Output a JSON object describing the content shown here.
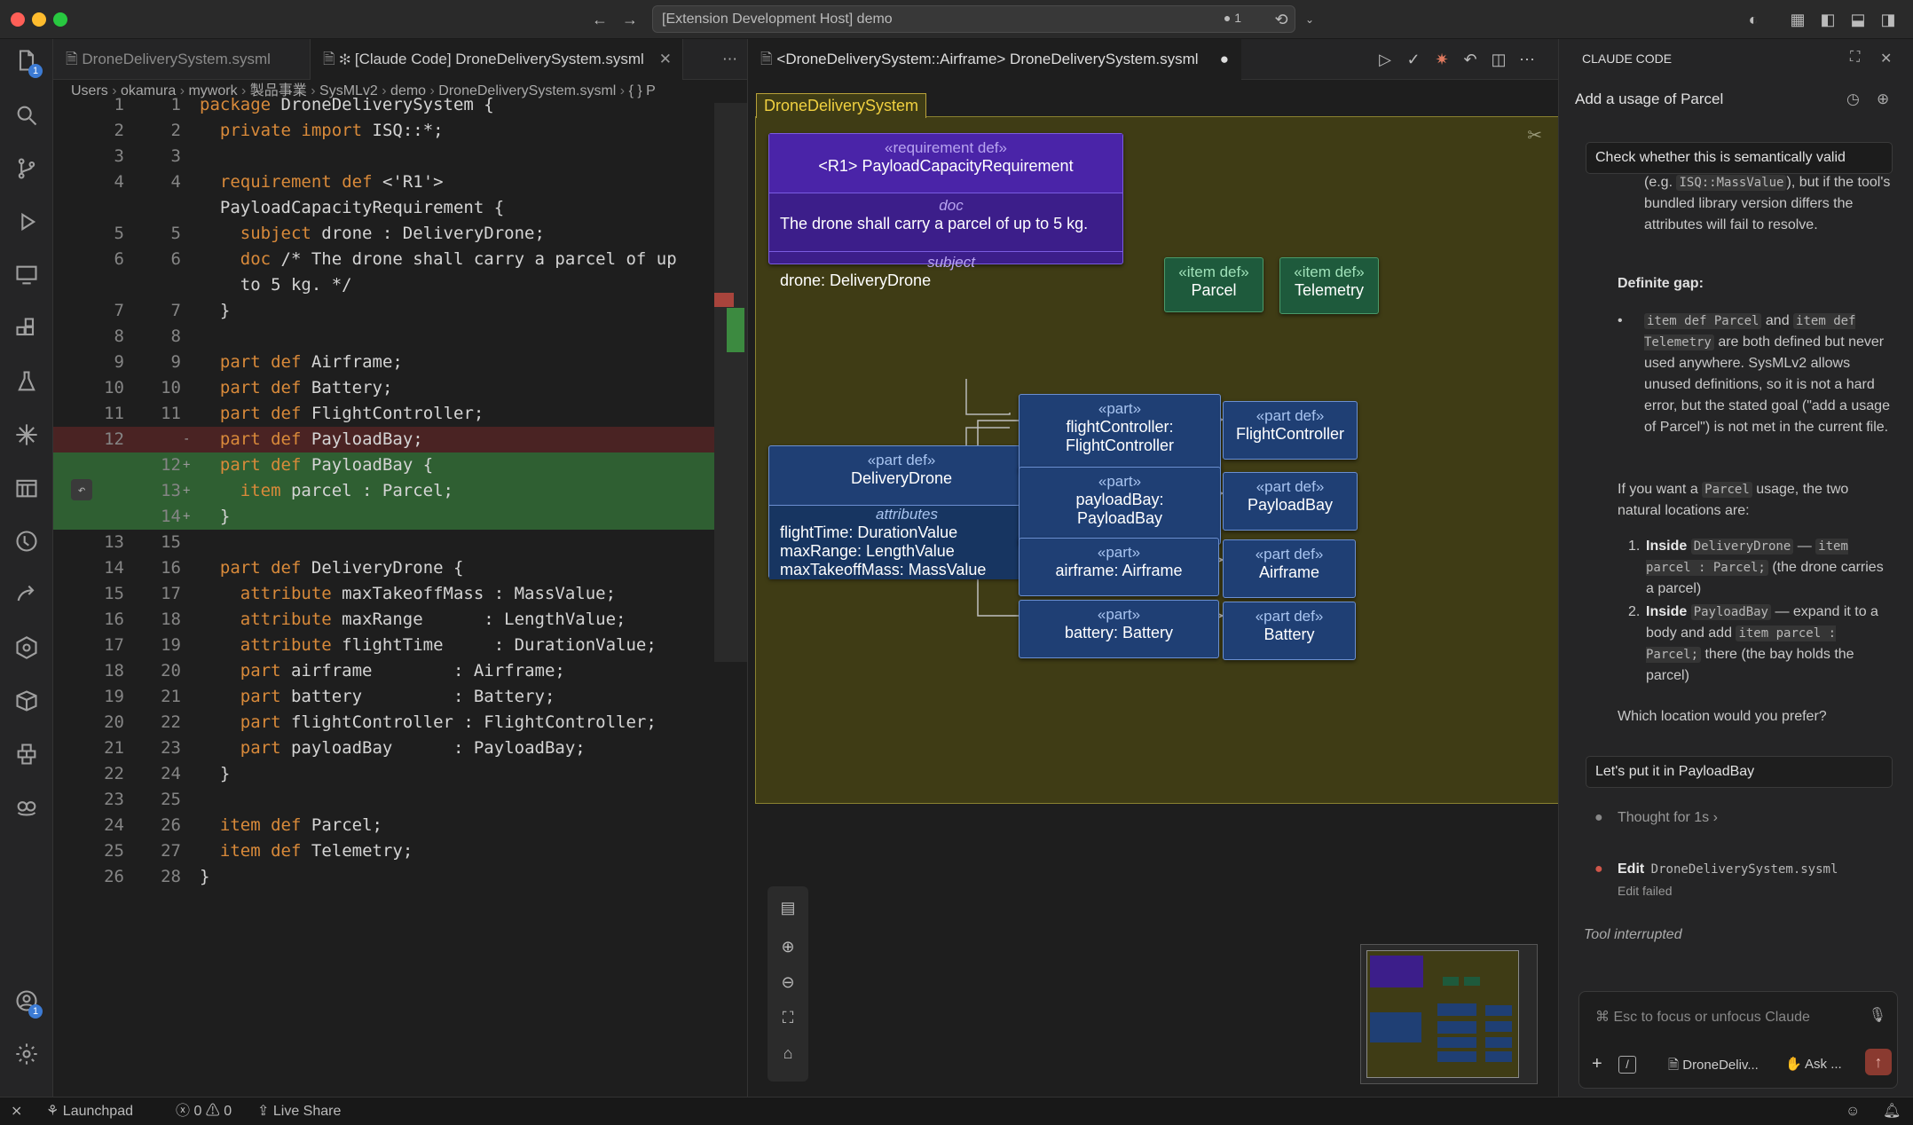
{
  "window": {
    "title": "[Extension Development Host] demo",
    "notif_count": "1"
  },
  "activity": {
    "explorer_badge": "1",
    "account_badge": "1"
  },
  "editor_tabs": [
    {
      "label": "DroneDeliverySystem.sysml"
    },
    {
      "label": "✻ [Claude Code] DroneDeliverySystem.sysml"
    }
  ],
  "breadcrumb": [
    "Users",
    "okamura",
    "mywork",
    "製品事業",
    "SysMLv2",
    "demo",
    "DroneDeliverySystem.sysml",
    "{ } P"
  ],
  "code_lines": [
    {
      "ln1": "1",
      "ln2": "1",
      "mark": "",
      "text": "package DroneDeliverySystem {",
      "kind": "normal"
    },
    {
      "ln1": "2",
      "ln2": "2",
      "mark": "",
      "text": "  private import ISQ::*;",
      "kind": "normal"
    },
    {
      "ln1": "3",
      "ln2": "3",
      "mark": "",
      "text": "",
      "kind": "normal"
    },
    {
      "ln1": "4",
      "ln2": "4",
      "mark": "",
      "text": "  requirement def <'R1'>",
      "kind": "normal"
    },
    {
      "ln1": "",
      "ln2": "",
      "mark": "",
      "text": "  PayloadCapacityRequirement {",
      "kind": "normal"
    },
    {
      "ln1": "5",
      "ln2": "5",
      "mark": "",
      "text": "    subject drone : DeliveryDrone;",
      "kind": "normal"
    },
    {
      "ln1": "6",
      "ln2": "6",
      "mark": "",
      "text": "    doc /* The drone shall carry a parcel of up",
      "kind": "normal"
    },
    {
      "ln1": "",
      "ln2": "",
      "mark": "",
      "text": "    to 5 kg. */",
      "kind": "normal"
    },
    {
      "ln1": "7",
      "ln2": "7",
      "mark": "",
      "text": "  }",
      "kind": "normal"
    },
    {
      "ln1": "8",
      "ln2": "8",
      "mark": "",
      "text": "",
      "kind": "normal"
    },
    {
      "ln1": "9",
      "ln2": "9",
      "mark": "",
      "text": "  part def Airframe;",
      "kind": "normal"
    },
    {
      "ln1": "10",
      "ln2": "10",
      "mark": "",
      "text": "  part def Battery;",
      "kind": "normal"
    },
    {
      "ln1": "11",
      "ln2": "11",
      "mark": "",
      "text": "  part def FlightController;",
      "kind": "normal"
    },
    {
      "ln1": "12",
      "ln2": "",
      "mark": "-",
      "text": "  part def PayloadBay;",
      "kind": "del"
    },
    {
      "ln1": "",
      "ln2": "12",
      "mark": "+",
      "text": "  part def PayloadBay {",
      "kind": "add"
    },
    {
      "ln1": "",
      "ln2": "13",
      "mark": "+",
      "text": "    item parcel : Parcel;",
      "kind": "add"
    },
    {
      "ln1": "",
      "ln2": "14",
      "mark": "+",
      "text": "  }",
      "kind": "add"
    },
    {
      "ln1": "13",
      "ln2": "15",
      "mark": "",
      "text": "",
      "kind": "normal"
    },
    {
      "ln1": "14",
      "ln2": "16",
      "mark": "",
      "text": "  part def DeliveryDrone {",
      "kind": "normal"
    },
    {
      "ln1": "15",
      "ln2": "17",
      "mark": "",
      "text": "    attribute maxTakeoffMass : MassValue;",
      "kind": "normal"
    },
    {
      "ln1": "16",
      "ln2": "18",
      "mark": "",
      "text": "    attribute maxRange      : LengthValue;",
      "kind": "normal"
    },
    {
      "ln1": "17",
      "ln2": "19",
      "mark": "",
      "text": "    attribute flightTime     : DurationValue;",
      "kind": "normal"
    },
    {
      "ln1": "18",
      "ln2": "20",
      "mark": "",
      "text": "    part airframe        : Airframe;",
      "kind": "normal"
    },
    {
      "ln1": "19",
      "ln2": "21",
      "mark": "",
      "text": "    part battery         : Battery;",
      "kind": "normal"
    },
    {
      "ln1": "20",
      "ln2": "22",
      "mark": "",
      "text": "    part flightController : FlightController;",
      "kind": "normal"
    },
    {
      "ln1": "21",
      "ln2": "23",
      "mark": "",
      "text": "    part payloadBay      : PayloadBay;",
      "kind": "normal"
    },
    {
      "ln1": "22",
      "ln2": "24",
      "mark": "",
      "text": "  }",
      "kind": "normal"
    },
    {
      "ln1": "23",
      "ln2": "25",
      "mark": "",
      "text": "",
      "kind": "normal"
    },
    {
      "ln1": "24",
      "ln2": "26",
      "mark": "",
      "text": "  item def Parcel;",
      "kind": "normal"
    },
    {
      "ln1": "25",
      "ln2": "27",
      "mark": "",
      "text": "  item def Telemetry;",
      "kind": "normal"
    },
    {
      "ln1": "26",
      "ln2": "28",
      "mark": "",
      "text": "}",
      "kind": "normal"
    }
  ],
  "diagram": {
    "tab_label": "<DroneDeliverySystem::Airframe> DroneDeliverySystem.sysml",
    "package_name": "DroneDeliverySystem",
    "requirement": {
      "stereotype": "«requirement def»",
      "name": "<R1> PayloadCapacityRequirement",
      "doc_label": "doc",
      "doc": "The drone shall carry a parcel of up to 5 kg.",
      "subject_label": "subject",
      "subject": "drone: DeliveryDrone"
    },
    "parcel": {
      "stereotype": "«item def»",
      "name": "Parcel"
    },
    "telemetry": {
      "stereotype": "«item def»",
      "name": "Telemetry"
    },
    "drone": {
      "stereotype": "«part def»",
      "name": "DeliveryDrone",
      "attr_label": "attributes",
      "attrs": [
        "flightTime: DurationValue",
        "maxRange: LengthValue",
        "maxTakeoffMass: MassValue"
      ]
    },
    "parts": [
      {
        "stereotype": "«part»",
        "name": "flightController: FlightController",
        "def_stereotype": "«part def»",
        "def_name": "FlightController"
      },
      {
        "stereotype": "«part»",
        "name": "payloadBay: PayloadBay",
        "def_stereotype": "«part def»",
        "def_name": "PayloadBay"
      },
      {
        "stereotype": "«part»",
        "name": "airframe: Airframe",
        "def_stereotype": "«part def»",
        "def_name": "Airframe"
      },
      {
        "stereotype": "«part»",
        "name": "battery: Battery",
        "def_stereotype": "«part def»",
        "def_name": "Battery"
      }
    ]
  },
  "claude": {
    "header": "CLAUDE CODE",
    "subtitle": "Add a usage of Parcel",
    "user_msg1": "Check whether this is semantically valid",
    "p1_a": "(e.g.",
    "p1_code": "ISQ::MassValue",
    "p1_b": "), but if the tool's bundled library version differs the attributes will fail to resolve.",
    "gap_title": "Definite gap:",
    "gap_code1": "item def Parcel",
    "gap_and": "and",
    "gap_code2": "item def Telemetry",
    "gap_text": "are both defined but never used anywhere. SysMLv2 allows unused definitions, so it is not a hard error, but the stated goal (\"add a usage of Parcel\") is not met in the current file.",
    "want_a": "If you want a",
    "want_code": "Parcel",
    "want_b": "usage, the two natural locations are:",
    "opt1_title": "Inside",
    "opt1_code": "DeliveryDrone",
    "opt1_dash": "—",
    "opt1_code2": "item parcel : Parcel;",
    "opt1_text": "(the drone carries a parcel)",
    "opt2_title": "Inside",
    "opt2_code": "PayloadBay",
    "opt2_text": "— expand it to a body and add",
    "opt2_code2": "item parcel : Parcel;",
    "opt2_text2": "there (the bay holds the parcel)",
    "question": "Which location would you prefer?",
    "user_msg2": "Let's put it in PayloadBay",
    "thought": "Thought for 1s",
    "edit_label": "Edit",
    "edit_file": "DroneDeliverySystem.sysml",
    "edit_status": "Edit failed",
    "interrupted": "Tool interrupted",
    "input_placeholder": "⌘ Esc to focus or unfocus Claude",
    "file_chip": "DroneDeliv...",
    "mode_chip": "Ask ..."
  },
  "status": {
    "launchpad": "Launchpad",
    "errors": "0",
    "warnings": "0",
    "live_share": "Live Share"
  },
  "colors": {
    "accent": "#3c7bd4",
    "part_fill": "#1f3f74",
    "req_fill": "#3c1e8a",
    "item_fill": "#1e5a3c",
    "package_fill": "#3f3c15"
  }
}
